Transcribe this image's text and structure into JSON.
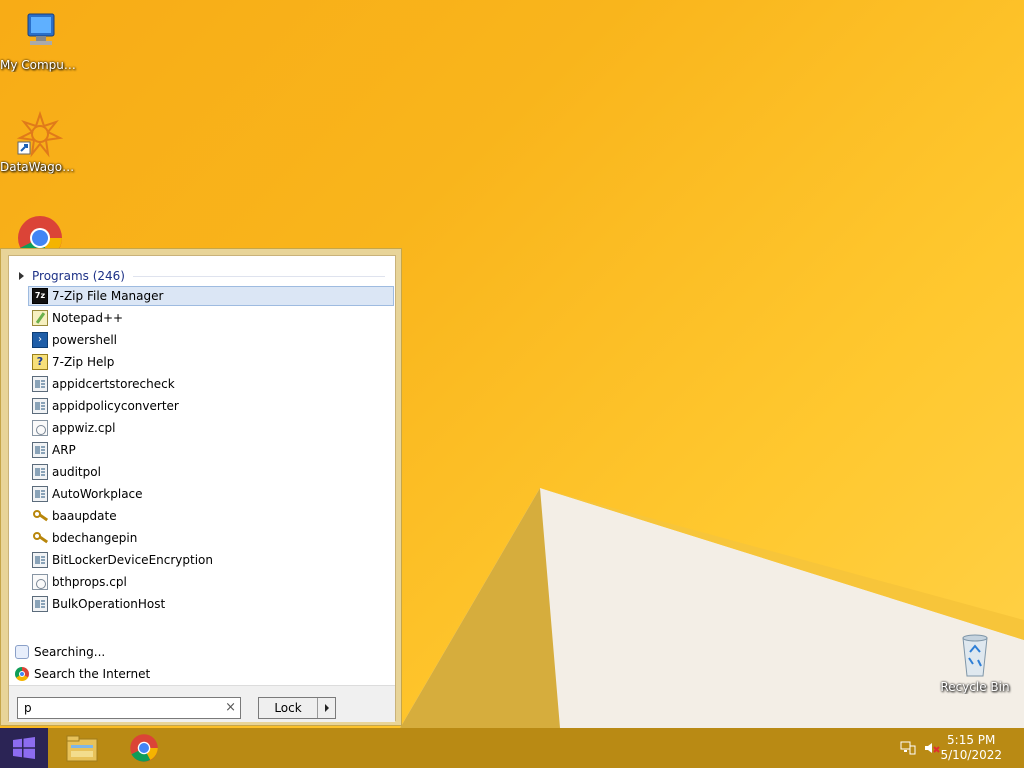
{
  "desktop": {
    "icons": [
      {
        "label": "My Computer",
        "icon": "computer-icon"
      },
      {
        "label": "DataWagon...",
        "icon": "datawagon-icon"
      },
      {
        "label": "",
        "icon": "chrome-icon"
      },
      {
        "label": "Recycle Bin",
        "icon": "recycle-bin-icon"
      }
    ]
  },
  "start_menu": {
    "programs_header": "Programs (246)",
    "programs": [
      {
        "label": "7-Zip File Manager",
        "icon": "7zip-icon",
        "selected": true
      },
      {
        "label": "Notepad++",
        "icon": "notepadpp-icon"
      },
      {
        "label": "powershell",
        "icon": "powershell-icon"
      },
      {
        "label": "7-Zip Help",
        "icon": "help-icon"
      },
      {
        "label": "appidcertstorecheck",
        "icon": "app-icon"
      },
      {
        "label": "appidpolicyconverter",
        "icon": "app-icon"
      },
      {
        "label": "appwiz.cpl",
        "icon": "cpl-icon"
      },
      {
        "label": "ARP",
        "icon": "app-icon"
      },
      {
        "label": "auditpol",
        "icon": "app-icon"
      },
      {
        "label": "AutoWorkplace",
        "icon": "app-icon"
      },
      {
        "label": "baaupdate",
        "icon": "key-icon"
      },
      {
        "label": "bdechangepin",
        "icon": "key-icon"
      },
      {
        "label": "BitLockerDeviceEncryption",
        "icon": "app-icon"
      },
      {
        "label": "bthprops.cpl",
        "icon": "cpl-icon"
      },
      {
        "label": "BulkOperationHost",
        "icon": "app-icon"
      }
    ],
    "searching_label": "Searching...",
    "search_internet_label": "Search the Internet",
    "search_value": "p",
    "search_clear": "×",
    "lock_label": "Lock"
  },
  "taskbar": {
    "time": "5:15 PM",
    "date": "5/10/2022"
  },
  "colors": {
    "wallpaper": "#f9b51c",
    "taskbar": "#b98a14",
    "start_button": "#2b2455",
    "selection": "#dbe6f5"
  }
}
